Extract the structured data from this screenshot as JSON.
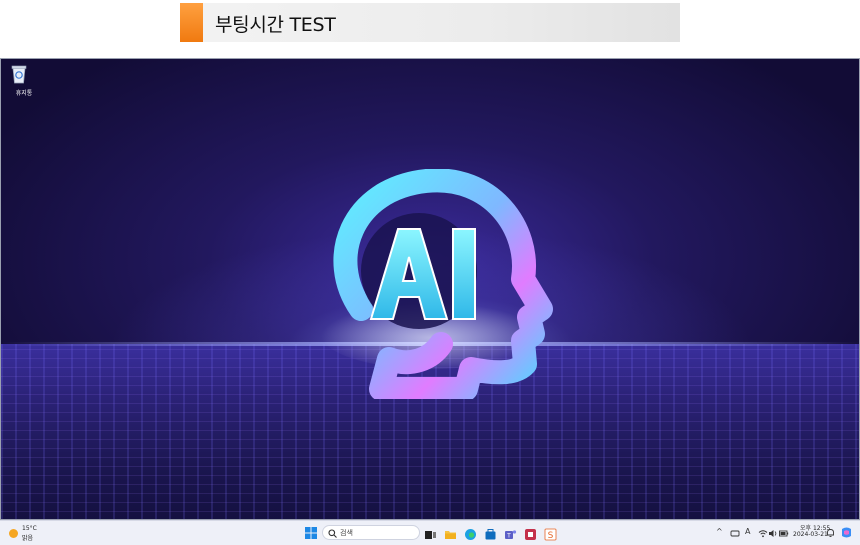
{
  "banner": {
    "title": "부팅시간 TEST"
  },
  "desktop": {
    "icons": [
      {
        "label": "휴지통",
        "icon": "recycle-bin-icon"
      }
    ],
    "wallpaper_text": "AI"
  },
  "taskbar": {
    "weather": {
      "temp": "15°C",
      "desc": "맑음"
    },
    "search": {
      "placeholder": "검색"
    },
    "apps": [
      "task-view-icon",
      "file-explorer-icon",
      "edge-icon",
      "store-icon",
      "teams-icon",
      "office-icon",
      "app-s-icon"
    ],
    "tray": {
      "chevron": "^",
      "ime": "A"
    },
    "clock": {
      "time": "오후 12:55",
      "date": "2024-03-21"
    }
  },
  "colors": {
    "accent": "#f07a10",
    "taskbar": "#eef0f8"
  }
}
